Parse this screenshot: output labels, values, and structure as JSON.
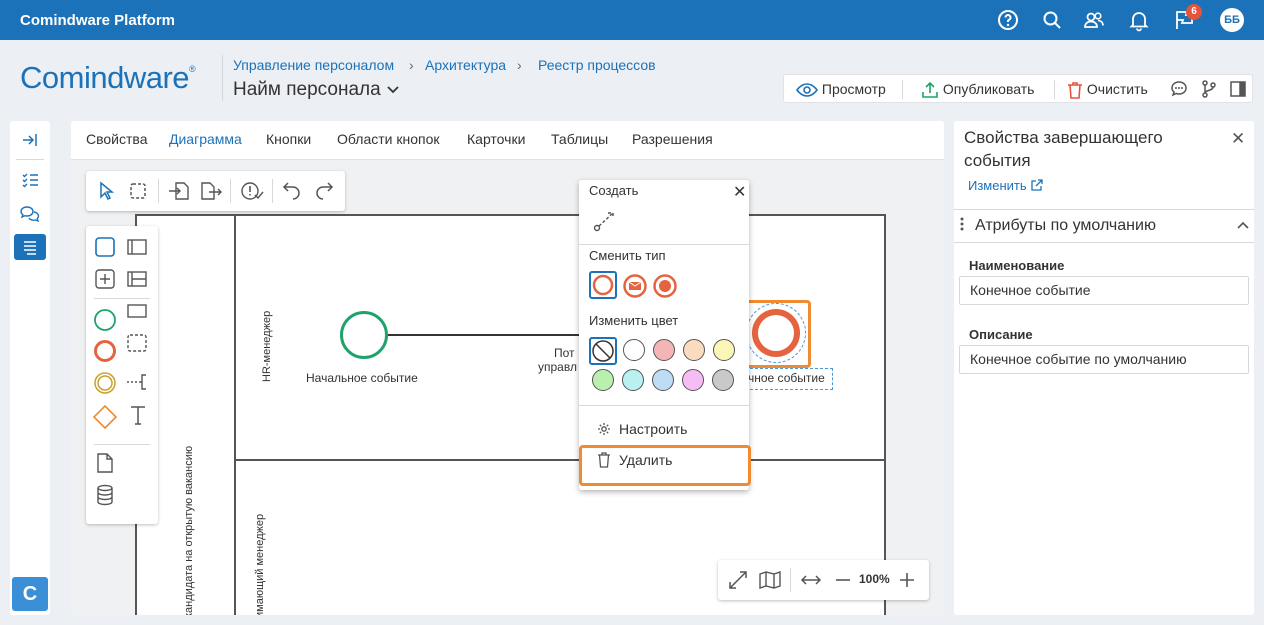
{
  "topbar": {
    "app_title": "Comindware Platform",
    "notifications_count": "6",
    "user_initials": "ББ",
    "icons": [
      "help-icon",
      "search-icon",
      "users-icon",
      "bell-icon",
      "flag-icon"
    ]
  },
  "header": {
    "logo": "Comindware",
    "logo_mark": "®",
    "breadcrumbs": [
      "Управление персоналом",
      "Архитектура",
      "Реестр процессов"
    ],
    "title": "Найм персонала"
  },
  "toolbar": {
    "view_label": "Просмотр",
    "publish_label": "Опубликовать",
    "clear_label": "Очистить"
  },
  "tabs": [
    "Свойства",
    "Диаграмма",
    "Кнопки",
    "Области кнопок",
    "Карточки",
    "Таблицы",
    "Разрешения"
  ],
  "active_tab": "Диаграмма",
  "diagram": {
    "pool_label": "кандидата на открытую вакансию",
    "lanes": [
      "HR-менеджер",
      "имающий менеджер"
    ],
    "start_event_label": "Начальное событие",
    "task_label_line1": "Пот",
    "task_label_line2": "управл",
    "end_event_label": "чное событие",
    "zoom": "100%"
  },
  "context_menu": {
    "create_label": "Создать",
    "change_type_label": "Сменить тип",
    "change_color_label": "Изменить цвет",
    "configure_label": "Настроить",
    "delete_label": "Удалить",
    "colors": [
      "none",
      "#ffffff",
      "#f5b5b5",
      "#f9dcc0",
      "#faf6b5",
      "#b9f0b0",
      "#b8f1f0",
      "#bddcf5",
      "#f5bdf3",
      "#c9c9c9"
    ]
  },
  "right_panel": {
    "title": "Свойства завершающего события",
    "edit_link": "Изменить",
    "section_label": "Атрибуты по умолчанию",
    "name_label": "Наименование",
    "name_value": "Конечное событие",
    "description_label": "Описание",
    "description_value": "Конечное событие по умолчанию"
  },
  "colors": {
    "brand": "#1c72b8",
    "highlight": "#ef8c33",
    "end_event": "#e5633f",
    "start_event": "#1fa36b"
  }
}
